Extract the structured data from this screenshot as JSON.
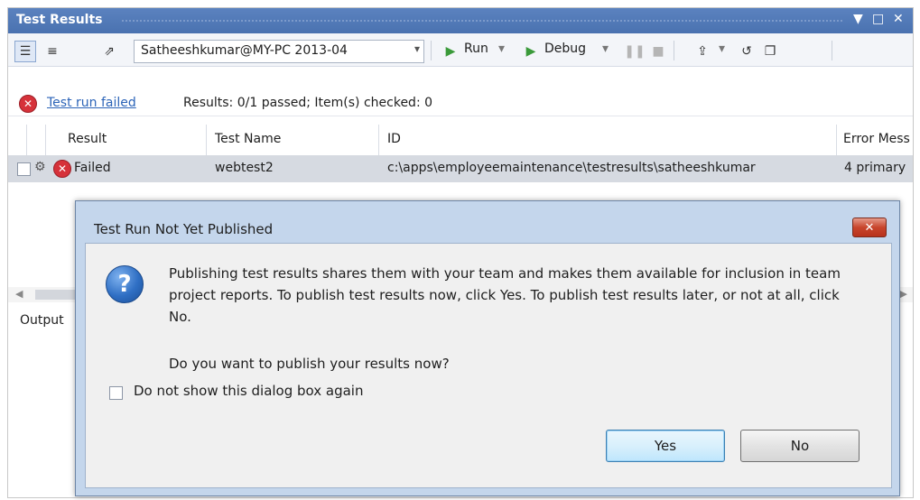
{
  "panel": {
    "title": "Test Results"
  },
  "toolbar": {
    "run_selector": "Satheeshkumar@MY-PC 2013-04",
    "run_label": "Run",
    "debug_label": "Debug"
  },
  "status": {
    "link": "Test run failed",
    "summary": "Results: 0/1 passed;  Item(s) checked: 0"
  },
  "grid": {
    "columns": [
      "Result",
      "Test Name",
      "ID",
      "Error Mess"
    ],
    "rows": [
      {
        "result": "Failed",
        "test_name": "webtest2",
        "id": "c:\\apps\\employeemaintenance\\testresults\\satheeshkumar",
        "error": "4 primary"
      }
    ]
  },
  "output_tab": "Output",
  "dialog": {
    "title": "Test Run Not Yet Published",
    "message": "Publishing test results shares them with your team and makes them available for inclusion in team project reports. To publish test results now, click Yes. To publish test results later, or not at all, click No.",
    "question": "Do you want to publish your results now?",
    "checkbox_label": "Do not show this dialog box again",
    "yes_label": "Yes",
    "no_label": "No"
  },
  "colors": {
    "titlebar": "#4e76b5",
    "error": "#d6323a",
    "link": "#2c64b8"
  },
  "icons": [
    "error-icon",
    "question-icon",
    "close-icon",
    "run-icon",
    "debug-icon",
    "pause-icon",
    "stop-icon"
  ]
}
